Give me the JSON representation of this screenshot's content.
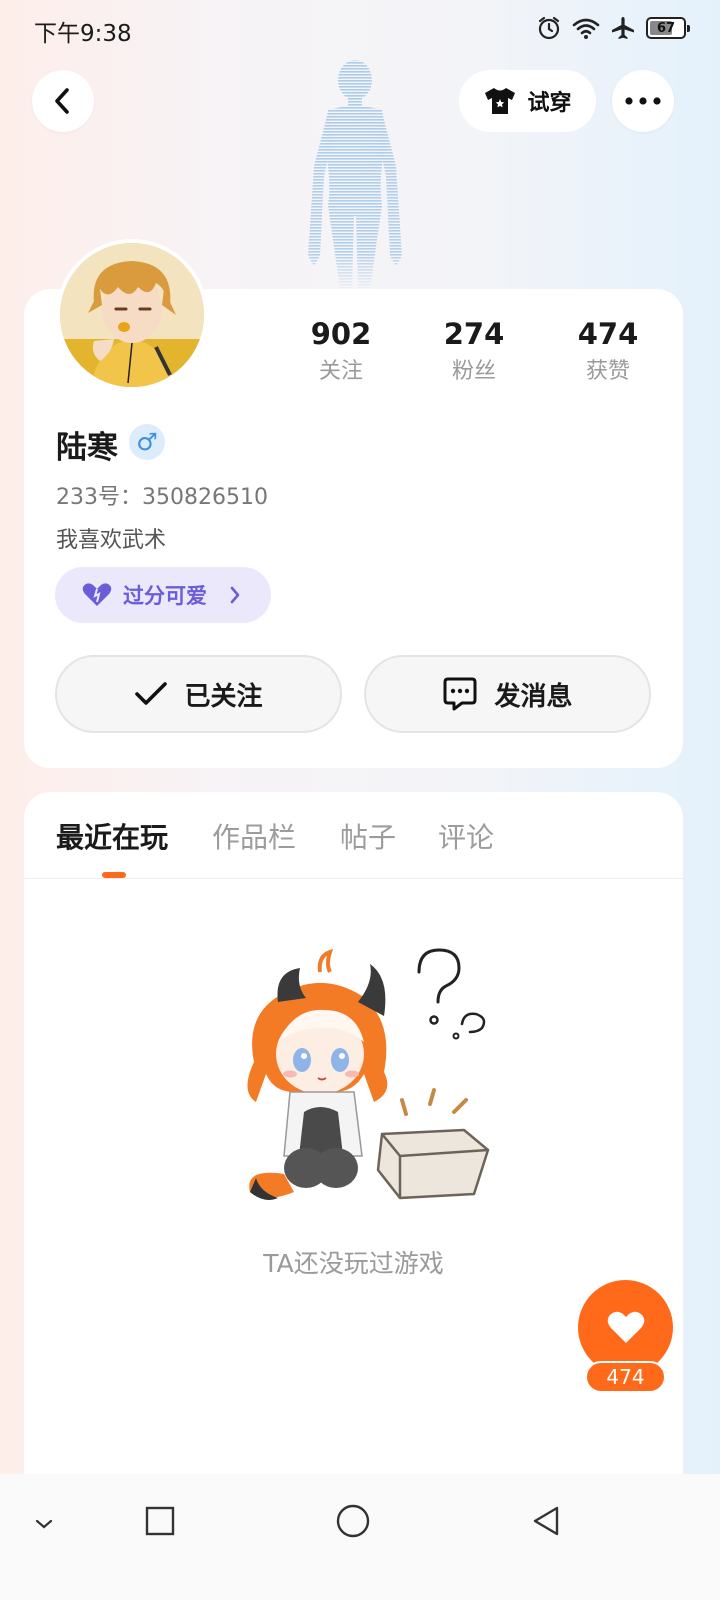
{
  "status_bar": {
    "time": "下午9:38",
    "battery": "67",
    "icons": [
      "alarm-icon",
      "wifi-icon",
      "airplane-icon",
      "battery-icon"
    ]
  },
  "header": {
    "tryon_label": "试穿"
  },
  "profile": {
    "name": "陆寒",
    "gender_symbol": "♂",
    "user_id": "233号：350826510",
    "bio": "我喜欢武术",
    "tag": "过分可爱",
    "stats": [
      {
        "value": "902",
        "label": "关注"
      },
      {
        "value": "274",
        "label": "粉丝"
      },
      {
        "value": "474",
        "label": "获赞"
      }
    ],
    "follow_label": "已关注",
    "message_label": "发消息"
  },
  "tabs": [
    {
      "label": "最近在玩",
      "active": true
    },
    {
      "label": "作品栏",
      "active": false
    },
    {
      "label": "帖子",
      "active": false
    },
    {
      "label": "评论",
      "active": false
    }
  ],
  "empty_state": {
    "text": "TA还没玩过游戏"
  },
  "like": {
    "count": "474"
  },
  "colors": {
    "accent": "#ff6a1a",
    "tag_text": "#6b5cd8",
    "tag_bg": "#ebe8fb",
    "gender": "#3d8fe0"
  }
}
